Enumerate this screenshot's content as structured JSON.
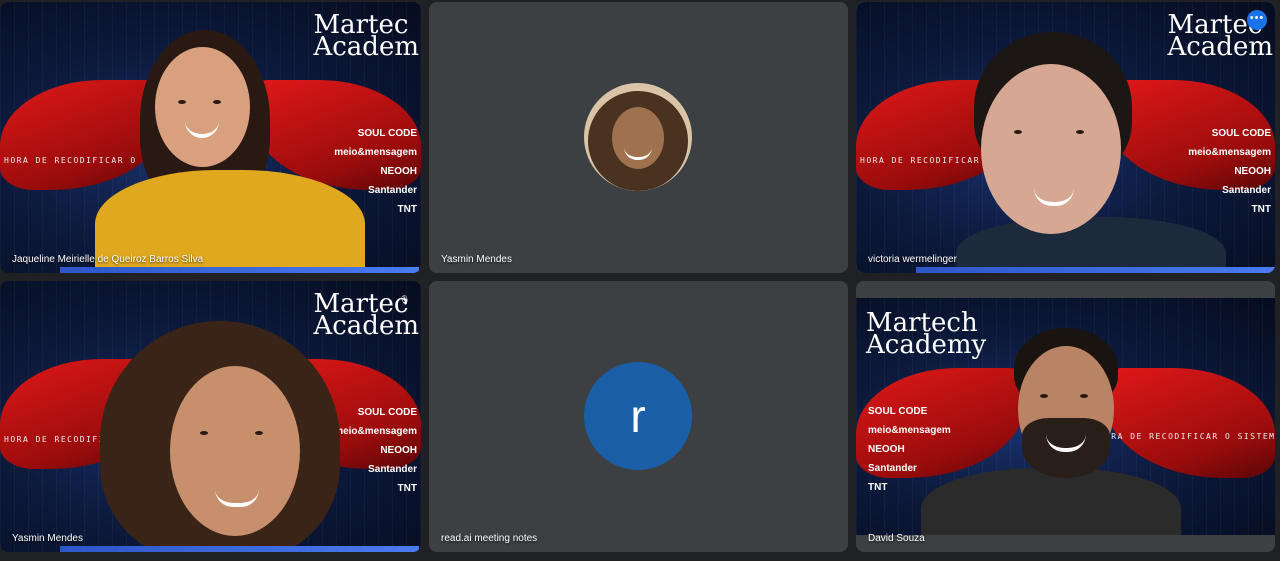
{
  "brand": {
    "line1": "Martec",
    "line2": "Academ"
  },
  "brand_mirrored": {
    "line1": "Martech",
    "line2": "Academy"
  },
  "tagline": "HORA DE RECODIFICAR O SISTEMA",
  "tagline_mirrored": "É HORA DE RECODIFICAR O SISTEMA",
  "sponsors": [
    "SOUL CODE",
    "meio&mensagem",
    "NEOOH",
    "Santander",
    "TNT"
  ],
  "participants": [
    {
      "name": "Jaqueline Meirielle de Queiroz Barros Silva"
    },
    {
      "name": "Yasmin Mendes"
    },
    {
      "name": "victoria wermelinger"
    },
    {
      "name": "Yasmin Mendes"
    },
    {
      "name": "read.ai meeting notes",
      "initial": "r"
    },
    {
      "name": "David Souza"
    }
  ],
  "controls": {
    "more_options_icon": "more-horizontal-icon",
    "more_options_label": "•••"
  },
  "colors": {
    "active_border": "#8ab4f8",
    "avatar_blue": "#1a5fa8",
    "tile_bg": "#3c4043"
  }
}
